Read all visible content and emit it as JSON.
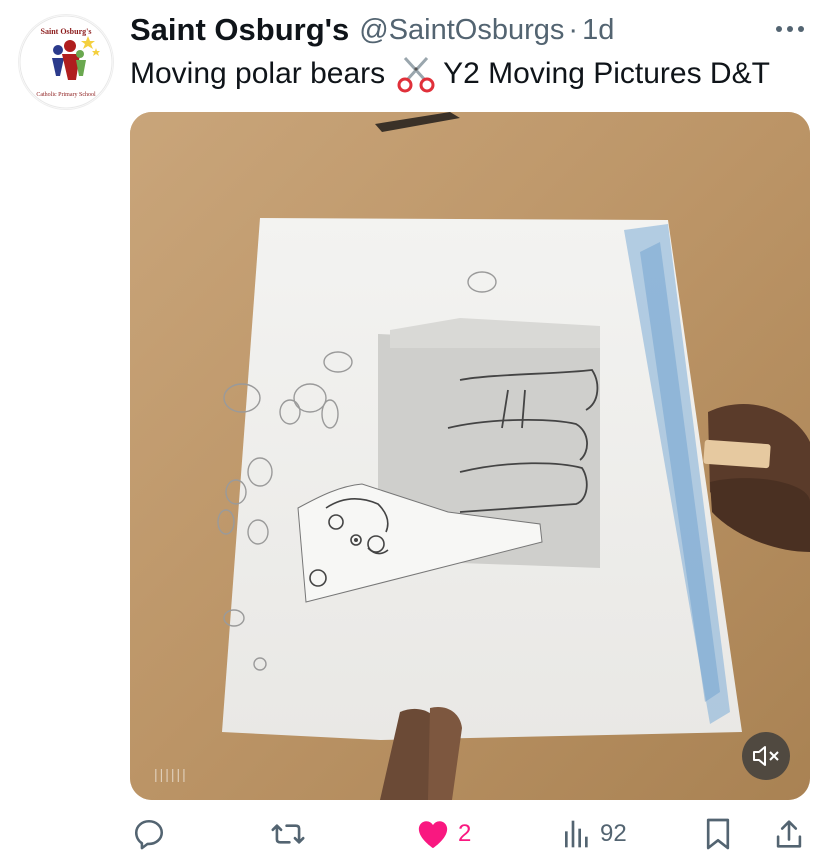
{
  "tweet": {
    "author_name": "Saint Osburg's",
    "handle": "@SaintOsburgs",
    "separator": "·",
    "timestamp": "1d",
    "text_before": "Moving polar bears",
    "text_after": "Y2 Moving Pictures D&T",
    "avatar_icon": "school-crest-logo",
    "avatar_text_top": "Saint Osburg's",
    "avatar_text_bottom": "Catholic Primary School"
  },
  "media": {
    "type": "video",
    "description_icon": "polar-bear-paper-craft",
    "muted": true,
    "scrub_marks": "||||||"
  },
  "actions": {
    "reply_count": "",
    "retweet_count": "",
    "like_count": "2",
    "like_color": "#f91880",
    "views_count": "92",
    "muted_color": "#536471"
  }
}
